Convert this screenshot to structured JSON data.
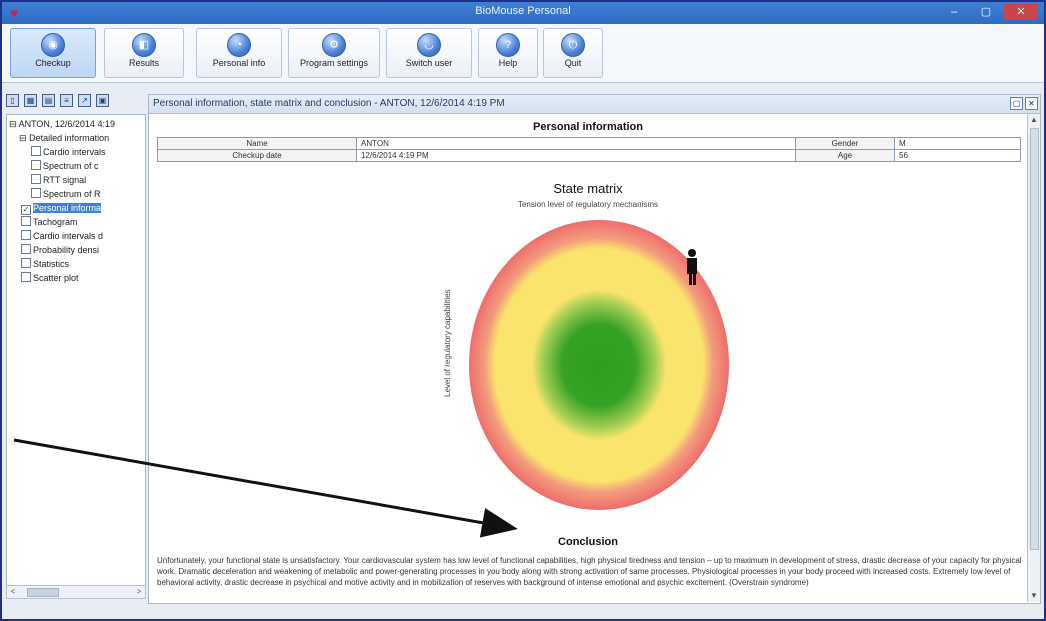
{
  "window": {
    "title": "BioMouse Personal",
    "minimize_glyph": "–",
    "maximize_glyph": "▢",
    "close_glyph": "✕"
  },
  "toolbar": {
    "buttons": [
      {
        "label": "Checkup",
        "icon": "checkup-icon",
        "glyph": "◉"
      },
      {
        "label": "Results",
        "icon": "results-icon",
        "glyph": "◧"
      },
      {
        "label": "Personal info",
        "icon": "personal-info-icon",
        "glyph": "◔"
      },
      {
        "label": "Program settings",
        "icon": "settings-icon",
        "glyph": "⚙"
      },
      {
        "label": "Switch user",
        "icon": "switch-user-icon",
        "glyph": "◡"
      },
      {
        "label": "Help",
        "icon": "help-icon",
        "glyph": "?"
      },
      {
        "label": "Quit",
        "icon": "quit-icon",
        "glyph": "⏻"
      }
    ]
  },
  "left_panel": {
    "tools": [
      "new-icon",
      "grid-icon",
      "table-icon",
      "list-icon",
      "export-icon",
      "print-icon"
    ],
    "tree": [
      {
        "label": "ANTON, 12/6/2014 4:19",
        "level": 0,
        "checkbox": false,
        "expanded": true
      },
      {
        "label": "Detailed information",
        "level": 1,
        "checkbox": false,
        "expanded": true
      },
      {
        "label": "Cardio intervals",
        "level": 2,
        "checkbox": true,
        "checked": false
      },
      {
        "label": "Spectrum of c",
        "level": 2,
        "checkbox": true,
        "checked": false
      },
      {
        "label": "RTT signal",
        "level": 2,
        "checkbox": true,
        "checked": false
      },
      {
        "label": "Spectrum of R",
        "level": 2,
        "checkbox": true,
        "checked": false
      },
      {
        "label": "Personal informa",
        "level": 1,
        "checkbox": true,
        "checked": true,
        "selected": true
      },
      {
        "label": "Tachogram",
        "level": 1,
        "checkbox": true,
        "checked": false
      },
      {
        "label": "Cardio intervals d",
        "level": 1,
        "checkbox": true,
        "checked": false
      },
      {
        "label": "Probability densi",
        "level": 1,
        "checkbox": true,
        "checked": false
      },
      {
        "label": "Statistics",
        "level": 1,
        "checkbox": true,
        "checked": false
      },
      {
        "label": "Scatter plot",
        "level": 1,
        "checkbox": true,
        "checked": false
      }
    ],
    "hscroll": {
      "left": "<",
      "right": ">"
    }
  },
  "content": {
    "header": "Personal information, state matrix and conclusion - ANTON, 12/6/2014 4:19 PM",
    "header_buttons": [
      "▢",
      "✕"
    ],
    "vscroll": {
      "up": "▲",
      "down": "▼"
    },
    "personal_info": {
      "title": "Personal information",
      "rows": [
        {
          "label": "Name",
          "value": "ANTON",
          "label2": "Gender",
          "value2": "M"
        },
        {
          "label": "Checkup date",
          "value": "12/6/2014 4:19 PM",
          "label2": "Age",
          "value2": "56"
        }
      ]
    },
    "state_matrix": {
      "title": "State matrix",
      "subtitle": "Tension level of regulatory mechanisms",
      "ylabel": "Level of regulatory capabilities",
      "colors": {
        "outer": "#ee6d6d",
        "middle": "#fbe46d",
        "inner": "#2f9d1f"
      },
      "marker": "person-icon"
    },
    "conclusion": {
      "title": "Conclusion",
      "text": "Unfortunately, your functional state is unsatisfactory. Your cardiovascular system has low level of functional capabilities, high physical tiredness and tension – up to maximum in development of stress, drastic decrease of your capacity for physical work. Dramatic deceleration and weakening of metabolic and power-generating processes in you body along with strong activation of same processes. Physiological processes in your body proceed with increased costs. Extremely low level of behavioral activity, drastic decrease in psychical and motive activity and in mobilization of reserves with background of intense emotional and psychic excitement. (Overstrain syndrome)"
    }
  }
}
